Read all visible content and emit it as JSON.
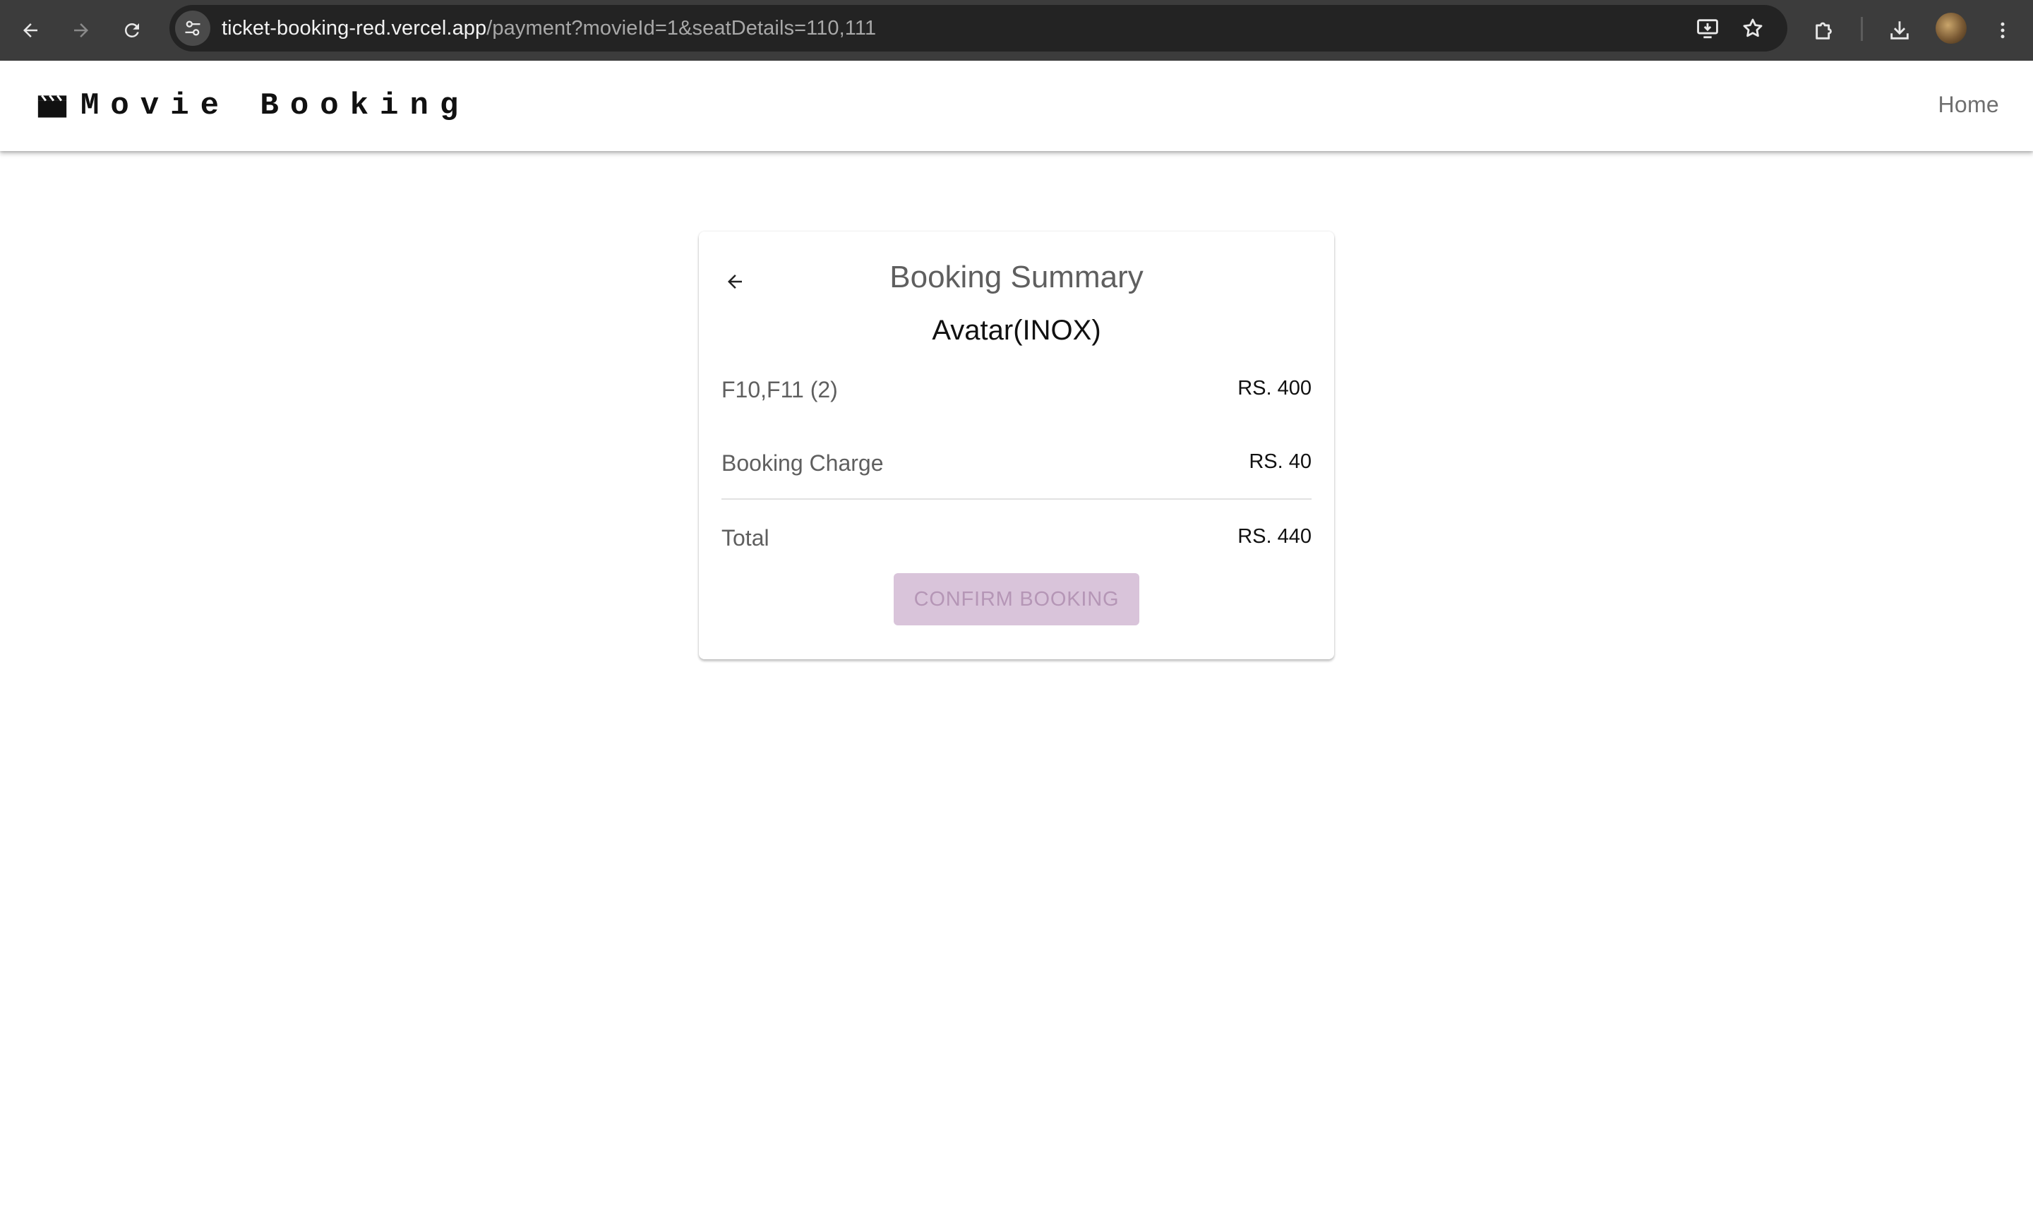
{
  "browser": {
    "url_host": "ticket-booking-red.vercel.app",
    "url_path": "/payment?movieId=1&seatDetails=110,111"
  },
  "app": {
    "brand": "Movie Booking",
    "nav_home": "Home"
  },
  "summary": {
    "title": "Booking Summary",
    "movie": "Avatar(INOX)",
    "seats_label": "F10,F11 (2)",
    "seats_amount": "RS. 400",
    "charge_label": "Booking Charge",
    "charge_amount": "RS. 40",
    "total_label": "Total",
    "total_amount": "RS. 440",
    "confirm_label": "CONFIRM BOOKING",
    "confirm_disabled": true
  },
  "colors": {
    "chrome_bg": "#3c3c3c",
    "omnibox_bg": "#232323",
    "confirm_bg_disabled": "#d9c4da",
    "confirm_text_disabled": "#b596b6"
  },
  "icons": {
    "browser_back": "arrow-left-icon",
    "browser_forward": "arrow-right-icon",
    "reload": "reload-icon",
    "site_info": "tune-icon",
    "install": "install-app-icon",
    "bookmark": "star-icon",
    "extensions": "puzzle-icon",
    "downloads": "download-icon",
    "menu": "kebab-menu-icon",
    "brand": "clapperboard-icon",
    "card_back": "arrow-left-icon"
  }
}
